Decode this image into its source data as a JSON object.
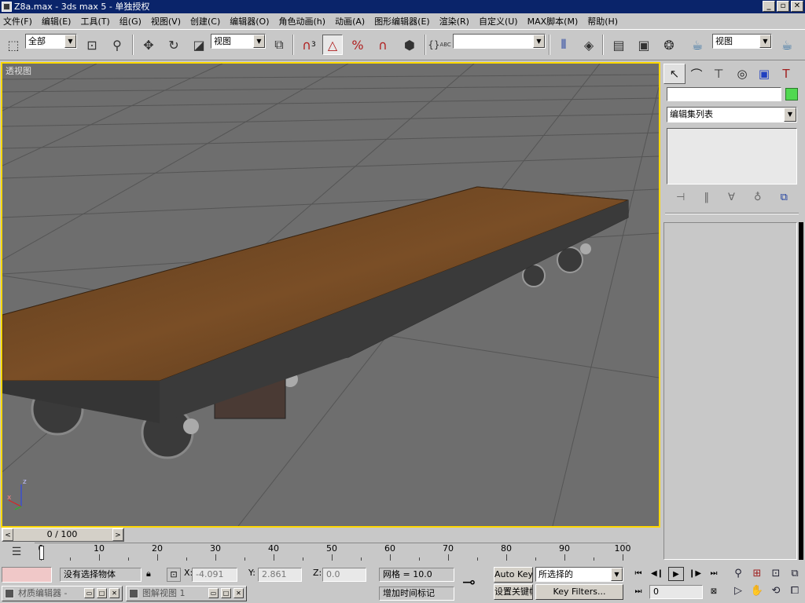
{
  "window": {
    "title": "Z8a.max - 3ds max 5 - 单独授权",
    "min_label": "_",
    "max_label": "▫",
    "close_label": "✕"
  },
  "menu": [
    "文件(F)",
    "编辑(E)",
    "工具(T)",
    "组(G)",
    "视图(V)",
    "创建(C)",
    "编辑器(O)",
    "角色动画(h)",
    "动画(A)",
    "图形编辑器(E)",
    "渲染(R)",
    "自定义(U)",
    "MAX脚本(M)",
    "帮助(H)"
  ],
  "toolbar": {
    "selection_filter": "全部",
    "ref_coord": "视图",
    "named_selection": "",
    "render_view": "视图",
    "snap_label": "3",
    "abc_label": "ABC"
  },
  "viewport": {
    "label": "透视图",
    "axis_z": "z",
    "axis_x": "x"
  },
  "command_panel": {
    "modifier_list": "编辑集列表",
    "object_name": "",
    "colors": {
      "object_color": "#50d850",
      "active_viewport_border": "#ffd800"
    }
  },
  "time": {
    "slider_value": "0 / 100",
    "ticks": [
      0,
      10,
      20,
      30,
      40,
      50,
      60,
      70,
      80,
      90,
      100
    ],
    "current_frame": "0"
  },
  "status": {
    "selection": "没有选择物体",
    "x_label": "X:",
    "x_value": "-4.091",
    "y_label": "Y:",
    "y_value": "2.861",
    "z_label": "Z:",
    "z_value": "0.0",
    "grid": "网格 = 10.0",
    "add_time_tag": "增加时间标记",
    "auto_key": "Auto Key",
    "set_key": "设置关键帧",
    "key_mode": "所选择的",
    "key_filters": "Key Filters..."
  },
  "taskbar": {
    "material_editor": "材质编辑器 -",
    "schematic_view": "图解视图 1"
  }
}
